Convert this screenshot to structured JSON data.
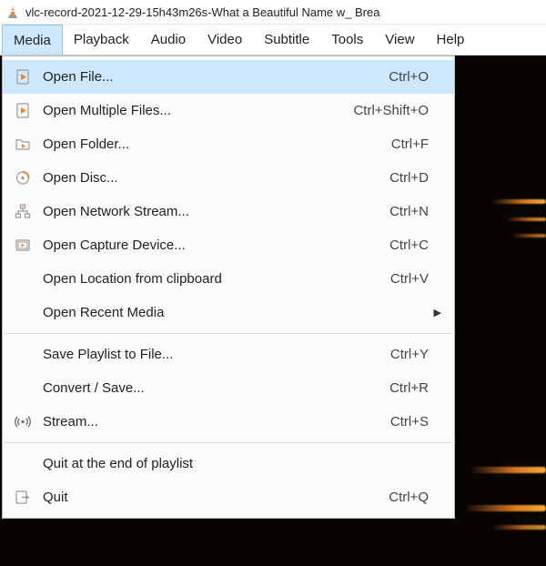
{
  "window": {
    "title": "vlc-record-2021-12-29-15h43m26s-What a Beautiful Name w_ Brea"
  },
  "menubar": {
    "items": [
      {
        "label": "Media",
        "active": true
      },
      {
        "label": "Playback",
        "active": false
      },
      {
        "label": "Audio",
        "active": false
      },
      {
        "label": "Video",
        "active": false
      },
      {
        "label": "Subtitle",
        "active": false
      },
      {
        "label": "Tools",
        "active": false
      },
      {
        "label": "View",
        "active": false
      },
      {
        "label": "Help",
        "active": false
      }
    ]
  },
  "menu": {
    "items": [
      {
        "icon": "file-play",
        "label": "Open File...",
        "shortcut": "Ctrl+O",
        "highlight": true
      },
      {
        "icon": "file-play",
        "label": "Open Multiple Files...",
        "shortcut": "Ctrl+Shift+O",
        "highlight": false
      },
      {
        "icon": "folder",
        "label": "Open Folder...",
        "shortcut": "Ctrl+F",
        "highlight": false
      },
      {
        "icon": "disc",
        "label": "Open Disc...",
        "shortcut": "Ctrl+D",
        "highlight": false
      },
      {
        "icon": "network",
        "label": "Open Network Stream...",
        "shortcut": "Ctrl+N",
        "highlight": false
      },
      {
        "icon": "capture",
        "label": "Open Capture Device...",
        "shortcut": "Ctrl+C",
        "highlight": false
      },
      {
        "icon": "",
        "label": "Open Location from clipboard",
        "shortcut": "Ctrl+V",
        "highlight": false
      },
      {
        "icon": "",
        "label": "Open Recent Media",
        "shortcut": "",
        "submenu": true,
        "highlight": false
      },
      {
        "sep": true
      },
      {
        "icon": "",
        "label": "Save Playlist to File...",
        "shortcut": "Ctrl+Y",
        "highlight": false
      },
      {
        "icon": "",
        "label": "Convert / Save...",
        "shortcut": "Ctrl+R",
        "highlight": false
      },
      {
        "icon": "stream",
        "label": "Stream...",
        "shortcut": "Ctrl+S",
        "highlight": false
      },
      {
        "sep": true
      },
      {
        "icon": "",
        "label": "Quit at the end of playlist",
        "shortcut": "",
        "highlight": false
      },
      {
        "icon": "quit",
        "label": "Quit",
        "shortcut": "Ctrl+Q",
        "highlight": false
      }
    ]
  },
  "colors": {
    "highlight_bg": "#cde8ff",
    "dropdown_border": "#b9b9b9",
    "video_bg": "#070402",
    "streak": "#ff8a28"
  }
}
